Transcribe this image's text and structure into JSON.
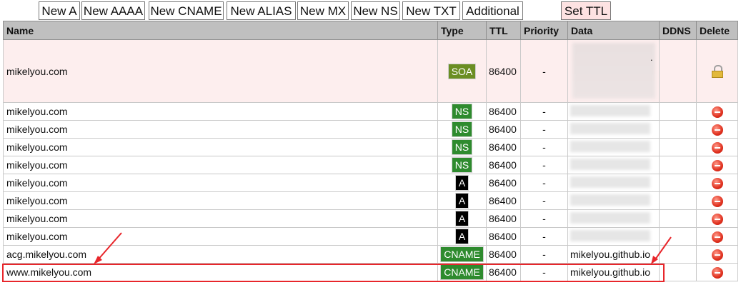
{
  "toolbar": {
    "buttons": [
      "New A",
      "New AAAA",
      "New CNAME",
      "New ALIAS",
      "New MX",
      "New NS",
      "New TXT",
      "Additional"
    ],
    "set_ttl": "Set TTL"
  },
  "table": {
    "headers": [
      "Name",
      "Type",
      "TTL",
      "Priority",
      "Data",
      "DDNS",
      "Delete"
    ],
    "rows": [
      {
        "name": "mikelyou.com",
        "type": "SOA",
        "ttl": "86400",
        "priority": "-",
        "data": "",
        "ddns": "",
        "delete": "lock"
      },
      {
        "name": "mikelyou.com",
        "type": "NS",
        "ttl": "86400",
        "priority": "-",
        "data": "",
        "ddns": "",
        "delete": "remove"
      },
      {
        "name": "mikelyou.com",
        "type": "NS",
        "ttl": "86400",
        "priority": "-",
        "data": "",
        "ddns": "",
        "delete": "remove"
      },
      {
        "name": "mikelyou.com",
        "type": "NS",
        "ttl": "86400",
        "priority": "-",
        "data": "",
        "ddns": "",
        "delete": "remove"
      },
      {
        "name": "mikelyou.com",
        "type": "NS",
        "ttl": "86400",
        "priority": "-",
        "data": "",
        "ddns": "",
        "delete": "remove"
      },
      {
        "name": "mikelyou.com",
        "type": "A",
        "ttl": "86400",
        "priority": "-",
        "data": "",
        "ddns": "",
        "delete": "remove"
      },
      {
        "name": "mikelyou.com",
        "type": "A",
        "ttl": "86400",
        "priority": "-",
        "data": "",
        "ddns": "",
        "delete": "remove"
      },
      {
        "name": "mikelyou.com",
        "type": "A",
        "ttl": "86400",
        "priority": "-",
        "data": "",
        "ddns": "",
        "delete": "remove"
      },
      {
        "name": "mikelyou.com",
        "type": "A",
        "ttl": "86400",
        "priority": "-",
        "data": "",
        "ddns": "",
        "delete": "remove"
      },
      {
        "name": "acg.mikelyou.com",
        "type": "CNAME",
        "ttl": "86400",
        "priority": "-",
        "data": "mikelyou.github.io",
        "ddns": "",
        "delete": "remove"
      },
      {
        "name": "www.mikelyou.com",
        "type": "CNAME",
        "ttl": "86400",
        "priority": "-",
        "data": "mikelyou.github.io",
        "ddns": "",
        "delete": "remove"
      }
    ]
  },
  "soa_data_fragment": ".",
  "colors": {
    "header_bg": "#bfbfbf",
    "soa_row_bg": "#fdeeee",
    "badge_ns": "#2e8b2e",
    "badge_soa": "#6b8e23",
    "badge_a": "#000000",
    "highlight": "#e8262b"
  },
  "icons": {
    "delete": "remove-circle-icon",
    "locked": "lock-icon"
  }
}
